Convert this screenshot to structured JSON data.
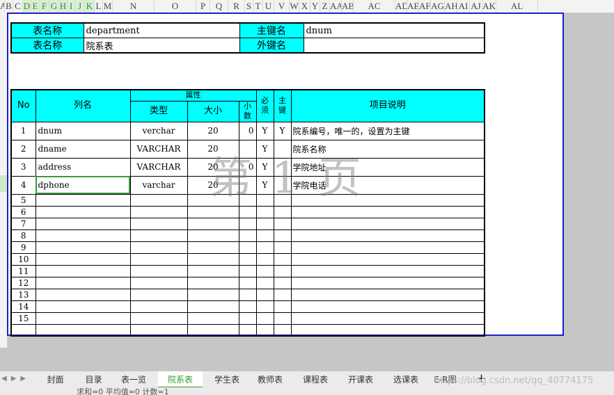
{
  "columns": [
    "A",
    "B",
    "C",
    "D",
    "E",
    "F",
    "G",
    "H",
    "I",
    "J",
    "K",
    "L",
    "M",
    "N",
    "O",
    "P",
    "Q",
    "R",
    "S",
    "T",
    "U",
    "V",
    "W",
    "X",
    "Y",
    "Z",
    "AA",
    "AB",
    "AC",
    "AD",
    "AE",
    "AF",
    "AG",
    "AH",
    "AI",
    "AJ",
    "AK",
    "AL"
  ],
  "table_info": {
    "name_label": "表名称",
    "name_value": "department",
    "pk_label": "主键名",
    "pk_value": "dnum",
    "name_label_2": "表名称",
    "name_value_2": "院系表",
    "fk_label": "外键名",
    "fk_value": ""
  },
  "grid": {
    "headers": {
      "no": "No",
      "column": "列名",
      "attr": "属性",
      "type": "类型",
      "size": "大小",
      "decimal": "小数",
      "required": "必须",
      "primary": "主键",
      "desc": "项目说明"
    },
    "rows": [
      {
        "no": "1",
        "column": "dnum",
        "type": "verchar",
        "size": "20",
        "decimal": "0",
        "required": "Y",
        "primary": "Y",
        "desc": "院系编号，唯一的，设置为主键"
      },
      {
        "no": "2",
        "column": "dname",
        "type": "VARCHAR",
        "size": "20",
        "decimal": "",
        "required": "Y",
        "primary": "",
        "desc": "院系名称"
      },
      {
        "no": "3",
        "column": "address",
        "type": "VARCHAR",
        "size": "20",
        "decimal": "0",
        "required": "Y",
        "primary": "",
        "desc": "学院地址"
      },
      {
        "no": "4",
        "column": "dphone",
        "type": "varchar",
        "size": "20",
        "decimal": "",
        "required": "Y",
        "primary": "",
        "desc": "学院电话"
      }
    ],
    "empty_rows": [
      "5",
      "6",
      "7",
      "8",
      "9",
      "10",
      "11",
      "12",
      "13",
      "14",
      "15",
      ""
    ]
  },
  "watermark": "第 1 页",
  "sheet_tabs": [
    "封面",
    "目录",
    "表一览",
    "院系表",
    "学生表",
    "教师表",
    "课程表",
    "开课表",
    "选课表",
    "E-R图"
  ],
  "active_tab": "院系表",
  "add_sheet": "+",
  "csdn_watermark": "https://blog.csdn.net/qq_40774175",
  "status_text": "求和=0  平均值=0  计数=1",
  "colors": {
    "header_cyan": "#00ffff",
    "page_border": "#1f1fc8",
    "active_tab": "#2f9a2f"
  }
}
